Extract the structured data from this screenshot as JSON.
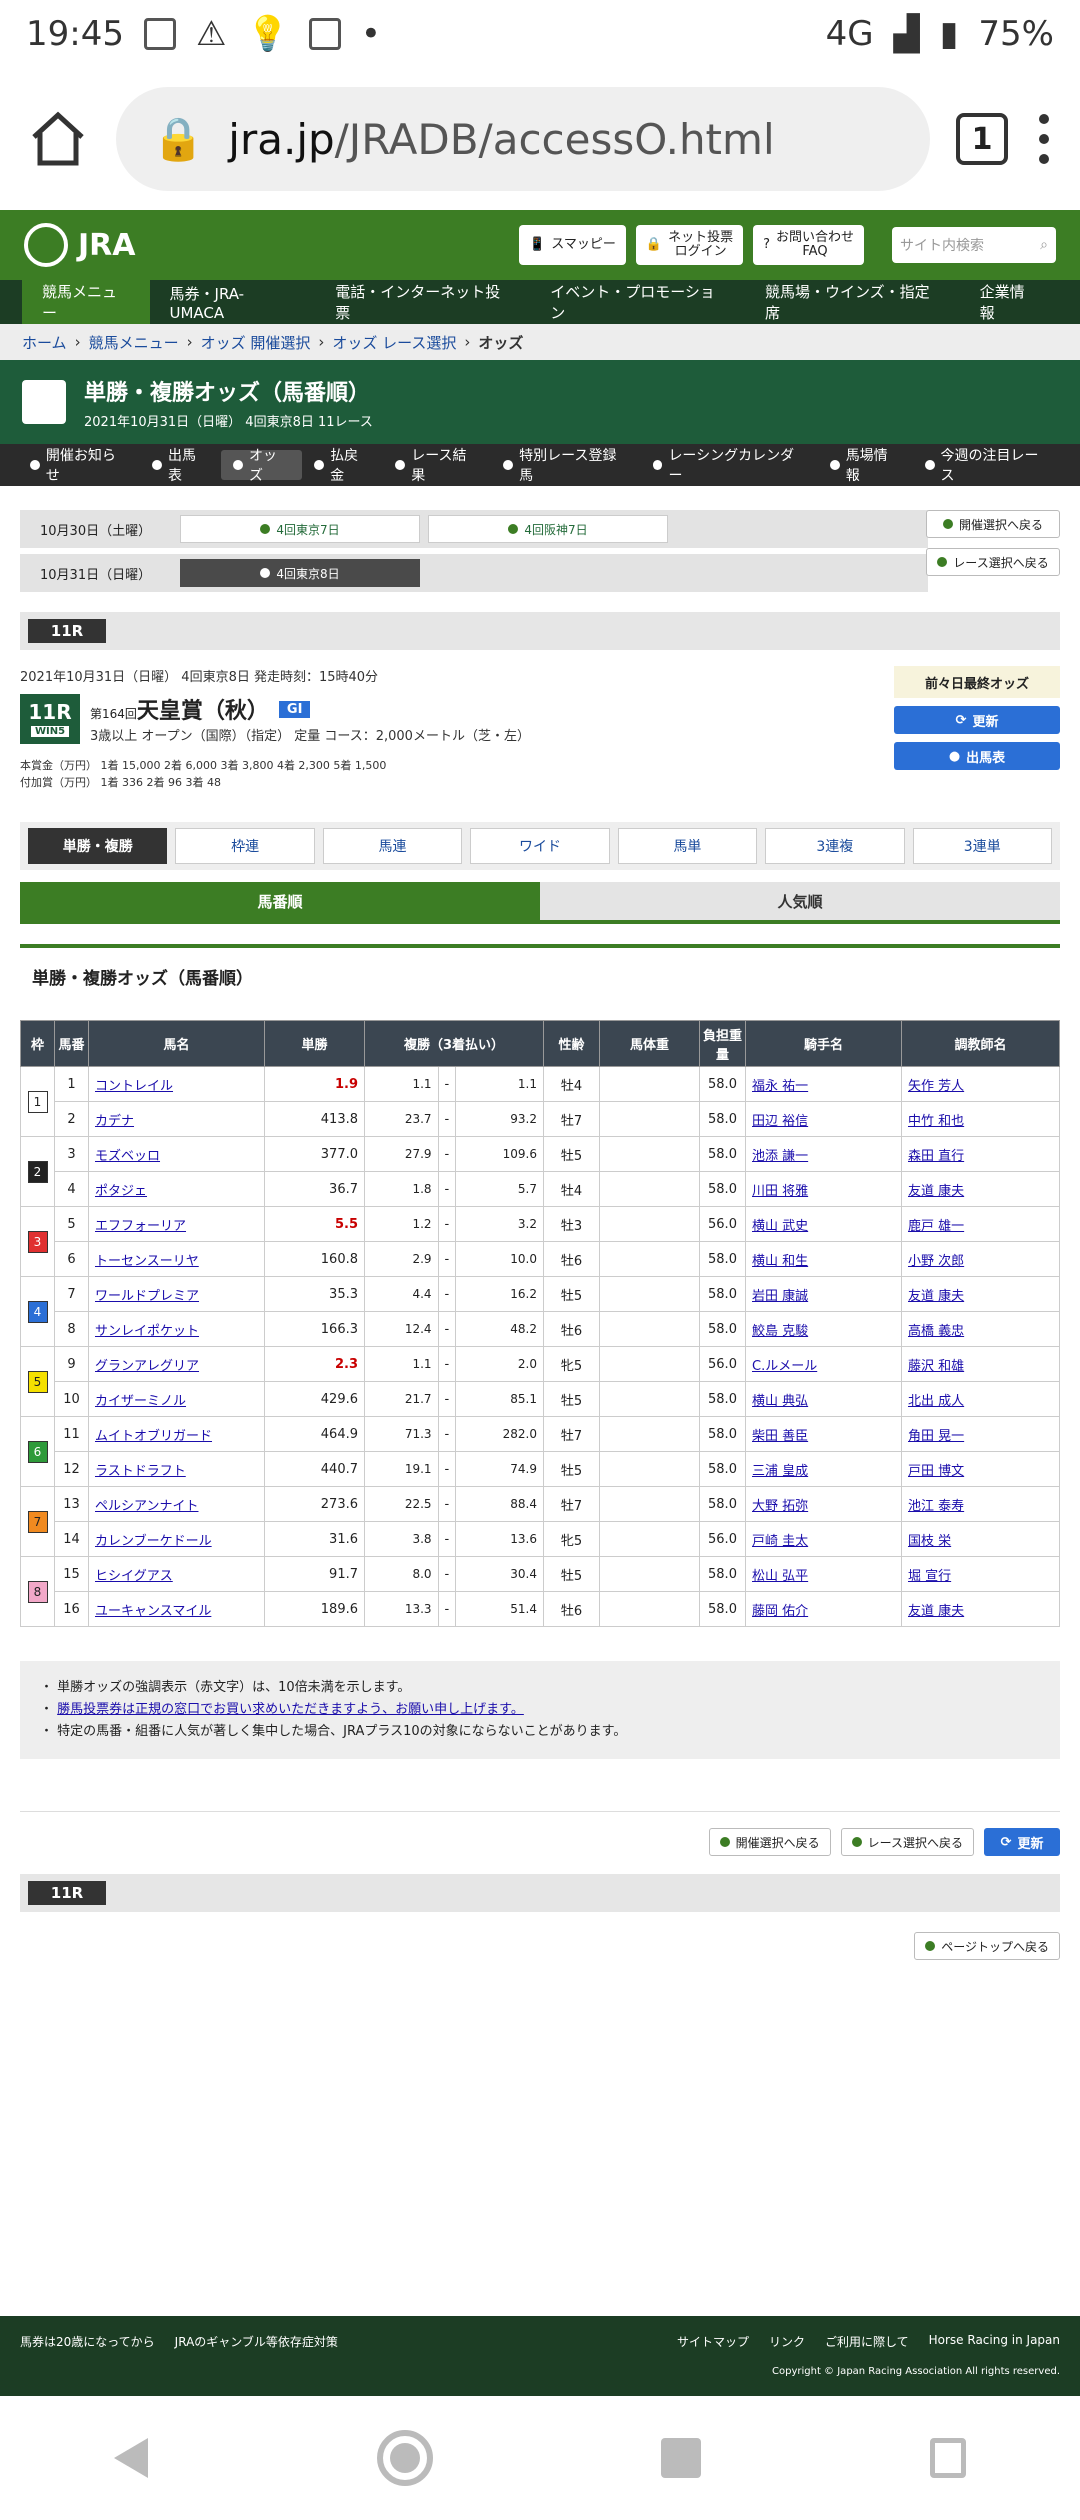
{
  "status": {
    "time": "19:45",
    "network": "4G",
    "battery": "75%"
  },
  "browser": {
    "url_domain": "jra.jp",
    "url_path": "/JRADB/accessO.html",
    "tab_count": "1"
  },
  "header": {
    "logo": "JRA",
    "buttons": [
      "スマッピー",
      "ネット投票\nログイン",
      "お問い合わせ\nFAQ"
    ],
    "search_placeholder": "サイト内検索"
  },
  "mainnav": [
    "競馬メニュー",
    "馬券・JRA-UMACA",
    "電話・インターネット投票",
    "イベント・プロモーション",
    "競馬場・ウインズ・指定席",
    "企業情報"
  ],
  "breadcrumb": [
    "ホーム",
    "競馬メニュー",
    "オッズ 開催選択",
    "オッズ レース選択",
    "オッズ"
  ],
  "title": {
    "main": "単勝・複勝オッズ（馬番順）",
    "sub": "2021年10月31日（日曜） 4回東京8日 11レース"
  },
  "subnav": [
    "開催お知らせ",
    "出馬表",
    "オッズ",
    "払戻金",
    "レース結果",
    "特別レース登録馬",
    "レーシングカレンダー",
    "馬場情報",
    "今週の注目レース"
  ],
  "days": [
    {
      "label": "10月30日（土曜）",
      "meets": [
        "4回東京7日",
        "4回阪神7日"
      ]
    },
    {
      "label": "10月31日（日曜）",
      "meets": [
        "4回東京8日"
      ]
    }
  ],
  "nav_buttons": {
    "back_meet": "開催選択へ戻る",
    "back_race": "レース選択へ戻る",
    "refresh": "更新",
    "entries": "出馬表",
    "prev_odds": "前々日最終オッズ",
    "page_top": "ページトップへ戻る"
  },
  "race": {
    "tag": "11R",
    "info_line": "2021年10月31日（日曜） 4回東京8日 発走時刻：15時40分",
    "num": "11R",
    "win5": "WIN5",
    "edition": "第164回",
    "name": "天皇賞（秋）",
    "grade": "GI",
    "conditions": "3歳以上 オープン（国際）（指定） 定量 コース：2,000メートル（芝・左）",
    "prize1": "本賞金（万円） 1着 15,000 2着 6,000 3着 3,800 4着 2,300 5着 1,500",
    "prize2": "付加賞（万円） 1着 336 2着 96 3着 48"
  },
  "bet_tabs": [
    "単勝・複勝",
    "枠連",
    "馬連",
    "ワイド",
    "馬単",
    "3連複",
    "3連単"
  ],
  "sort_tabs": [
    "馬番順",
    "人気順"
  ],
  "section_title": "単勝・複勝オッズ（馬番順）",
  "table": {
    "headers": [
      "枠",
      "馬番",
      "馬名",
      "単勝",
      "複勝（3着払い）",
      "性齢",
      "馬体重",
      "負担重量",
      "騎手名",
      "調教師名"
    ],
    "rows": [
      {
        "waku": "1",
        "num": "1",
        "name": "コントレイル",
        "win": "1.9",
        "hot": true,
        "pmin": "1.1",
        "pmax": "1.1",
        "sex": "牡4",
        "wt": "58.0",
        "jockey": "福永 祐一",
        "trainer": "矢作 芳人"
      },
      {
        "waku": "",
        "num": "2",
        "name": "カデナ",
        "win": "413.8",
        "hot": false,
        "pmin": "23.7",
        "pmax": "93.2",
        "sex": "牡7",
        "wt": "58.0",
        "jockey": "田辺 裕信",
        "trainer": "中竹 和也"
      },
      {
        "waku": "2",
        "num": "3",
        "name": "モズベッロ",
        "win": "377.0",
        "hot": false,
        "pmin": "27.9",
        "pmax": "109.6",
        "sex": "牡5",
        "wt": "58.0",
        "jockey": "池添 謙一",
        "trainer": "森田 直行"
      },
      {
        "waku": "",
        "num": "4",
        "name": "ポタジェ",
        "win": "36.7",
        "hot": false,
        "pmin": "1.8",
        "pmax": "5.7",
        "sex": "牡4",
        "wt": "58.0",
        "jockey": "川田 将雅",
        "trainer": "友道 康夫"
      },
      {
        "waku": "3",
        "num": "5",
        "name": "エフフォーリア",
        "win": "5.5",
        "hot": true,
        "pmin": "1.2",
        "pmax": "3.2",
        "sex": "牡3",
        "wt": "56.0",
        "jockey": "横山 武史",
        "trainer": "鹿戸 雄一"
      },
      {
        "waku": "",
        "num": "6",
        "name": "トーセンスーリヤ",
        "win": "160.8",
        "hot": false,
        "pmin": "2.9",
        "pmax": "10.0",
        "sex": "牡6",
        "wt": "58.0",
        "jockey": "横山 和生",
        "trainer": "小野 次郎"
      },
      {
        "waku": "4",
        "num": "7",
        "name": "ワールドプレミア",
        "win": "35.3",
        "hot": false,
        "pmin": "4.4",
        "pmax": "16.2",
        "sex": "牡5",
        "wt": "58.0",
        "jockey": "岩田 康誠",
        "trainer": "友道 康夫"
      },
      {
        "waku": "",
        "num": "8",
        "name": "サンレイポケット",
        "win": "166.3",
        "hot": false,
        "pmin": "12.4",
        "pmax": "48.2",
        "sex": "牡6",
        "wt": "58.0",
        "jockey": "鮫島 克駿",
        "trainer": "高橋 義忠"
      },
      {
        "waku": "5",
        "num": "9",
        "name": "グランアレグリア",
        "win": "2.3",
        "hot": true,
        "pmin": "1.1",
        "pmax": "2.0",
        "sex": "牝5",
        "wt": "56.0",
        "jockey": "C.ルメール",
        "trainer": "藤沢 和雄"
      },
      {
        "waku": "",
        "num": "10",
        "name": "カイザーミノル",
        "win": "429.6",
        "hot": false,
        "pmin": "21.7",
        "pmax": "85.1",
        "sex": "牡5",
        "wt": "58.0",
        "jockey": "横山 典弘",
        "trainer": "北出 成人"
      },
      {
        "waku": "6",
        "num": "11",
        "name": "ムイトオブリガード",
        "win": "464.9",
        "hot": false,
        "pmin": "71.3",
        "pmax": "282.0",
        "sex": "牡7",
        "wt": "58.0",
        "jockey": "柴田 善臣",
        "trainer": "角田 晃一"
      },
      {
        "waku": "",
        "num": "12",
        "name": "ラストドラフト",
        "win": "440.7",
        "hot": false,
        "pmin": "19.1",
        "pmax": "74.9",
        "sex": "牡5",
        "wt": "58.0",
        "jockey": "三浦 皇成",
        "trainer": "戸田 博文"
      },
      {
        "waku": "7",
        "num": "13",
        "name": "ペルシアンナイト",
        "win": "273.6",
        "hot": false,
        "pmin": "22.5",
        "pmax": "88.4",
        "sex": "牡7",
        "wt": "58.0",
        "jockey": "大野 拓弥",
        "trainer": "池江 泰寿"
      },
      {
        "waku": "",
        "num": "14",
        "name": "カレンブーケドール",
        "win": "31.6",
        "hot": false,
        "pmin": "3.8",
        "pmax": "13.6",
        "sex": "牝5",
        "wt": "56.0",
        "jockey": "戸崎 圭太",
        "trainer": "国枝 栄"
      },
      {
        "waku": "8",
        "num": "15",
        "name": "ヒシイグアス",
        "win": "91.7",
        "hot": false,
        "pmin": "8.0",
        "pmax": "30.4",
        "sex": "牡5",
        "wt": "58.0",
        "jockey": "松山 弘平",
        "trainer": "堀 宣行"
      },
      {
        "waku": "",
        "num": "16",
        "name": "ユーキャンスマイル",
        "win": "189.6",
        "hot": false,
        "pmin": "13.3",
        "pmax": "51.4",
        "sex": "牡6",
        "wt": "58.0",
        "jockey": "藤岡 佑介",
        "trainer": "友道 康夫"
      }
    ],
    "waku_colors": {
      "1": "#ffffff",
      "2": "#222222",
      "3": "#e03030",
      "4": "#2b6fd6",
      "5": "#f5e000",
      "6": "#2e9a3a",
      "7": "#f08a20",
      "8": "#f2a8c8"
    }
  },
  "notes": [
    "単勝オッズの強調表示（赤文字）は、10倍未満を示します。",
    "勝馬投票券は正規の窓口でお買い求めいただきますよう、お願い申し上げます。",
    "特定の馬番・組番に人気が著しく集中した場合、JRAプラス10の対象にならないことがあります。"
  ],
  "footer": {
    "left": [
      "馬券は20歳になってから",
      "JRAのギャンブル等依存症対策"
    ],
    "right": [
      "サイトマップ",
      "リンク",
      "ご利用に際して",
      "Horse Racing in Japan"
    ],
    "copyright": "Copyright © Japan Racing Association All rights reserved."
  }
}
